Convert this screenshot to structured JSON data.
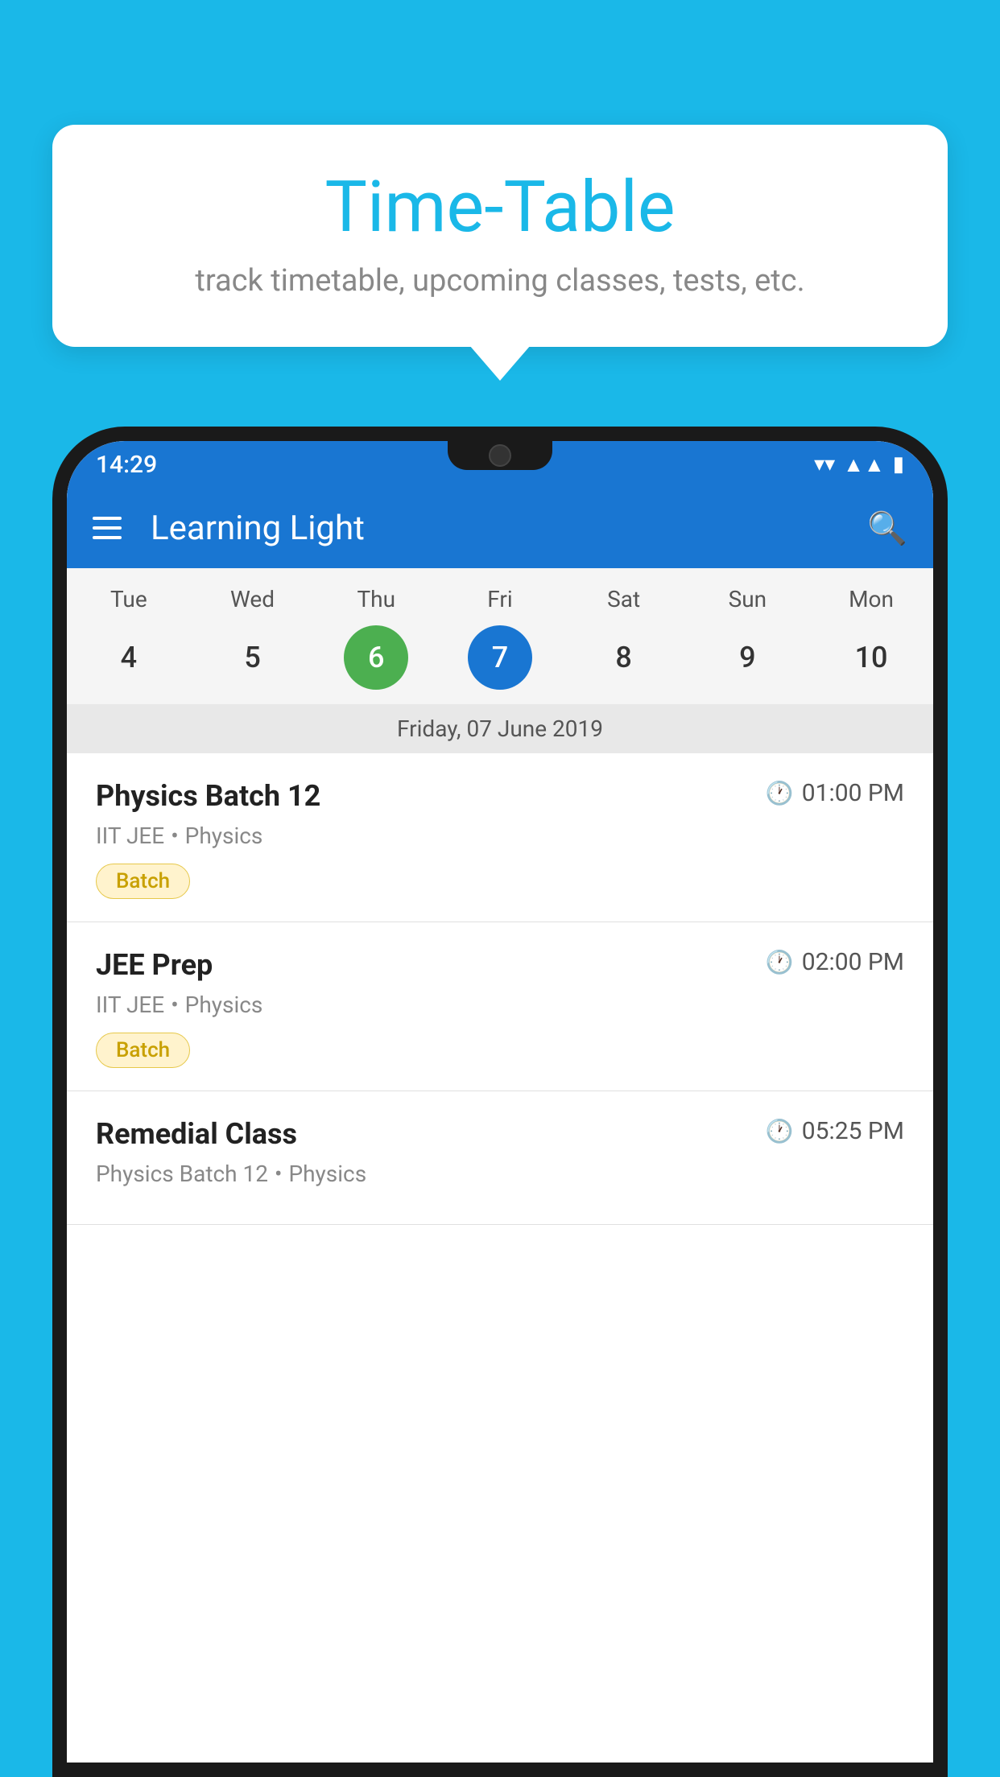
{
  "background_color": "#1ab8e8",
  "tooltip": {
    "title": "Time-Table",
    "subtitle": "track timetable, upcoming classes, tests, etc."
  },
  "phone": {
    "status_bar": {
      "time": "14:29"
    },
    "app_bar": {
      "title": "Learning Light"
    },
    "calendar": {
      "day_headers": [
        "Tue",
        "Wed",
        "Thu",
        "Fri",
        "Sat",
        "Sun",
        "Mon"
      ],
      "day_numbers": [
        4,
        5,
        6,
        7,
        8,
        9,
        10
      ],
      "today_index": 2,
      "selected_index": 3,
      "selected_date_label": "Friday, 07 June 2019"
    },
    "schedule_items": [
      {
        "title": "Physics Batch 12",
        "time": "01:00 PM",
        "subtitle_course": "IIT JEE",
        "subtitle_subject": "Physics",
        "badge": "Batch"
      },
      {
        "title": "JEE Prep",
        "time": "02:00 PM",
        "subtitle_course": "IIT JEE",
        "subtitle_subject": "Physics",
        "badge": "Batch"
      },
      {
        "title": "Remedial Class",
        "time": "05:25 PM",
        "subtitle_course": "Physics Batch 12",
        "subtitle_subject": "Physics",
        "badge": ""
      }
    ]
  },
  "icons": {
    "menu": "☰",
    "search": "🔍",
    "clock": "🕐"
  }
}
